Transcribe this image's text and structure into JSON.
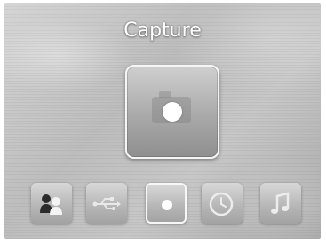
{
  "screen": {
    "title": "Capture"
  },
  "current_mode": {
    "name": "capture",
    "icon": "capture-icon"
  },
  "dock": {
    "items": [
      {
        "name": "users",
        "icon": "users-icon",
        "selected": false
      },
      {
        "name": "usb",
        "icon": "usb-icon",
        "selected": false
      },
      {
        "name": "capture",
        "icon": "capture-icon",
        "selected": true
      },
      {
        "name": "clock",
        "icon": "clock-icon",
        "selected": false
      },
      {
        "name": "music",
        "icon": "music-note-icon",
        "selected": false
      }
    ]
  },
  "colors": {
    "title_text": "#ffffff",
    "selection_border": "#f7f7f7",
    "tile_gradient_top": "#d8d8d8",
    "tile_gradient_bottom": "#a3a3a3"
  }
}
